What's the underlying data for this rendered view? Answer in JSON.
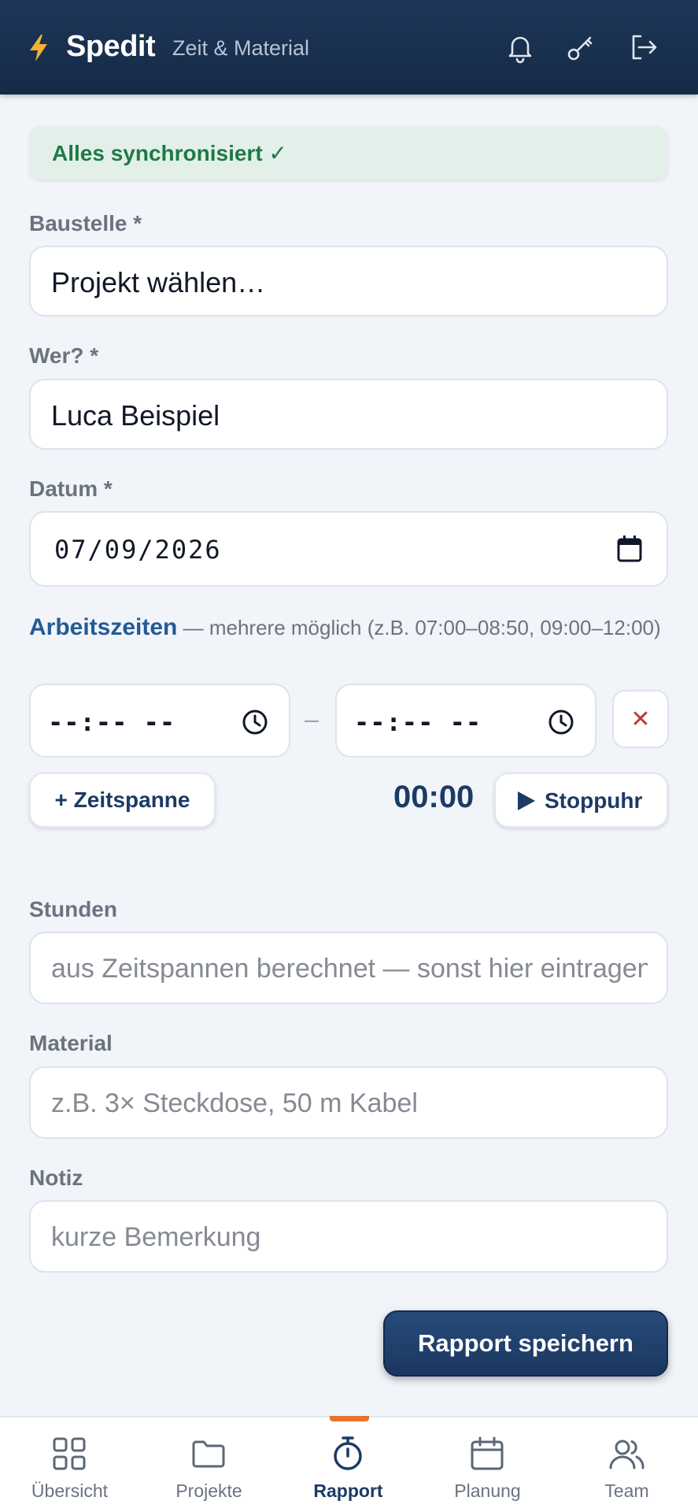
{
  "header": {
    "app_name": "Spedit",
    "subtitle": "Zeit & Material",
    "icons": [
      "bolt-icon",
      "bell-icon",
      "key-icon",
      "logout-icon"
    ]
  },
  "sync": {
    "text": "Alles synchronisiert ✓"
  },
  "form": {
    "site_label": "Baustelle *",
    "site_value": "Projekt wählen…",
    "who_label": "Wer? *",
    "who_value": "Luca Beispiel",
    "date_label": "Datum *",
    "date_value": "07/09/2026",
    "worktimes_title": "Arbeitszeiten",
    "worktimes_hint": " — mehrere möglich (z.B. 07:00–08:50, 09:00–12:00)",
    "time_from": "--:-- --",
    "time_separator": "–",
    "time_to": "--:-- --",
    "remove_label": "✕",
    "add_span_label": "+ Zeitspanne",
    "timer_value": "00:00",
    "stopwatch_label": "Stoppuhr",
    "hours_label": "Stunden",
    "hours_placeholder": "aus Zeitspannen berechnet — sonst hier eintragen",
    "material_label": "Material",
    "material_placeholder": "z.B. 3× Steckdose, 50 m Kabel",
    "note_label": "Notiz",
    "note_placeholder": "kurze Bemerkung",
    "save_label": "Rapport speichern"
  },
  "nav": {
    "items": [
      {
        "label": "Übersicht",
        "icon": "grid-icon"
      },
      {
        "label": "Projekte",
        "icon": "folder-icon"
      },
      {
        "label": "Rapport",
        "icon": "stopwatch-icon",
        "active": true
      },
      {
        "label": "Planung",
        "icon": "calendar-icon"
      },
      {
        "label": "Team",
        "icon": "team-icon"
      }
    ]
  },
  "colors": {
    "header": "#1e3658",
    "accent": "#e8732c",
    "primary": "#1c3a64",
    "success": "#1f7a45"
  }
}
